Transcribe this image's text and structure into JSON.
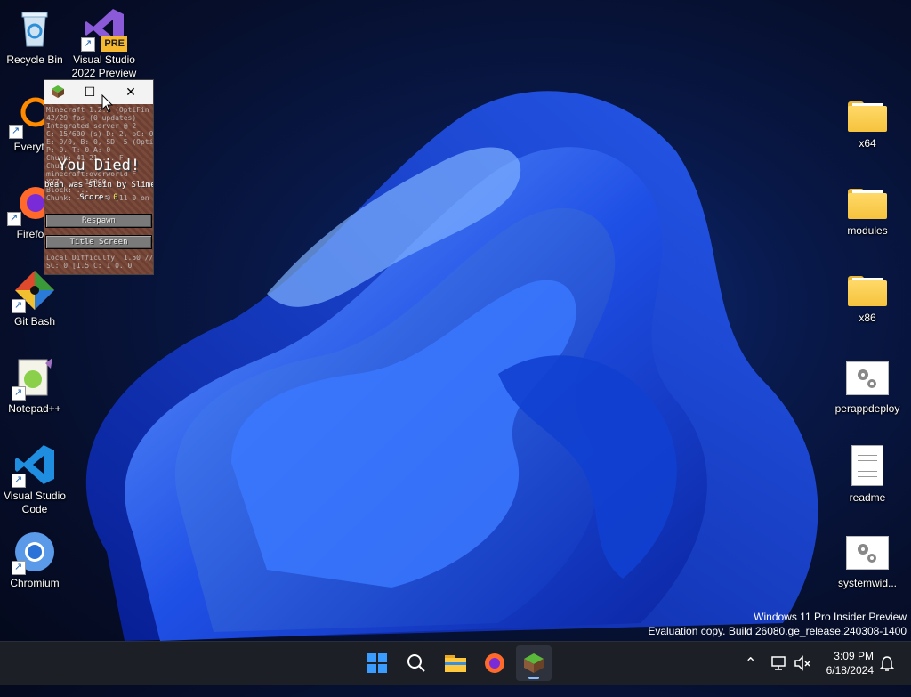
{
  "desktop": {
    "left_icons": [
      {
        "label": "Recycle Bin",
        "icon": "recycle-bin-icon"
      },
      {
        "label": "Visual Studio\n2022 Preview",
        "icon": "visual-studio-preview-icon",
        "badge": "PRE"
      },
      {
        "label": "Everyth",
        "icon": "everything-icon"
      },
      {
        "label": "Firefo",
        "icon": "firefox-icon"
      },
      {
        "label": "Git Bash",
        "icon": "git-bash-icon"
      },
      {
        "label": "Notepad++",
        "icon": "notepad-plus-plus-icon"
      },
      {
        "label": "Visual Studio\nCode",
        "icon": "vscode-icon"
      },
      {
        "label": "Chromium",
        "icon": "chromium-icon"
      }
    ],
    "right_icons": [
      {
        "label": "x64",
        "icon": "folder-icon"
      },
      {
        "label": "modules",
        "icon": "folder-icon"
      },
      {
        "label": "x86",
        "icon": "folder-icon"
      },
      {
        "label": "perappdeploy",
        "icon": "settings-file-icon"
      },
      {
        "label": "readme",
        "icon": "text-document-icon"
      },
      {
        "label": "systemwid...",
        "icon": "settings-file-icon"
      }
    ]
  },
  "minecraft": {
    "debug_lines": [
      "Minecraft 1.2.5 (OptiFin",
      "42/29 fps (0 updates)",
      "Integrated server @ 2",
      "C: 15/600 (s) D: 2, pC: 0",
      "E: 0/0, B: 0, SD: 5 (OptiF",
      "P: 0. T: 0 A: 0",
      "Chunk: 41 21 ... F",
      "Chu...",
      "minecraft:overworld F",
      "XYZ: ... 16000",
      "Block: ...",
      "Chunk: -1 ~ 4 0 [11 0 on"
    ],
    "title": "You Died!",
    "slain_text": "bean was slain by Slime",
    "score_label": "Score: ",
    "score_value": "0",
    "respawn_label": "Respawn",
    "title_screen_label": "Title Screen",
    "footer_lines": [
      "Local Difficulty: 1.50 //",
      "SC: 0 [1.5 C: 1 0. 0"
    ],
    "maximize_glyph": "☐",
    "close_glyph": "✕"
  },
  "watermark": {
    "line1": "Windows 11 Pro Insider Preview",
    "line2": "Evaluation copy. Build 26080.ge_release.240308-1400"
  },
  "taskbar": {
    "apps": [
      "start-icon",
      "search-icon",
      "file-explorer-icon",
      "firefox-icon",
      "minecraft-icon"
    ],
    "active_app": "minecraft-icon",
    "chevron": "⌃",
    "time": "3:09 PM",
    "date": "6/18/2024",
    "colors": {
      "accent": "#8cbcff",
      "taskbar_bg": "#1c1f26"
    }
  }
}
